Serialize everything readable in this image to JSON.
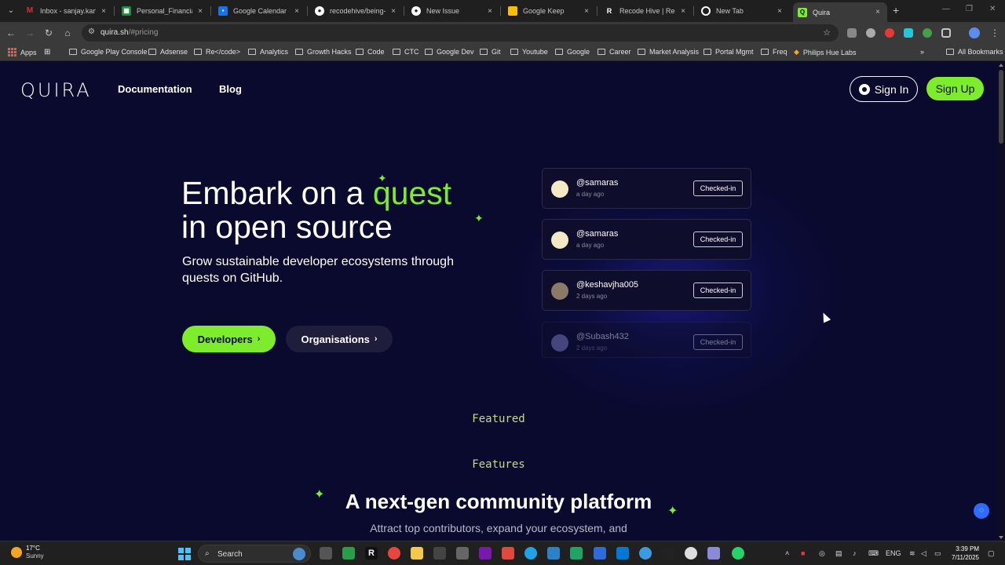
{
  "browser": {
    "tabs": [
      {
        "label": "Inbox - sanjay.kanaki",
        "icon": "gmail-icon",
        "color": "#d93025"
      },
      {
        "label": "Personal_Financial_St",
        "icon": "sheets-icon",
        "color": "#1e8e3e"
      },
      {
        "label": "Google Calendar - W",
        "icon": "calendar-icon",
        "color": "#1a73e8"
      },
      {
        "label": "recodehive/being-an",
        "icon": "github-icon",
        "color": "#ffffff"
      },
      {
        "label": "New Issue",
        "icon": "github-icon",
        "color": "#ffffff"
      },
      {
        "label": "Google Keep",
        "icon": "keep-icon",
        "color": "#fbbc04"
      },
      {
        "label": "Recode Hive | Recod",
        "icon": "recodehive-icon",
        "color": "#ffffff"
      },
      {
        "label": "New Tab",
        "icon": "chrome-icon",
        "color": "#ffffff"
      },
      {
        "label": "Quira",
        "icon": "quira-icon",
        "color": "#7cec2c"
      }
    ],
    "url_host": "quira.sh",
    "url_path": "/#pricing",
    "bookmarks": [
      "Apps",
      "Google Play Console",
      "Adsense",
      "Re</code>",
      "Analytics",
      "Growth Hacks",
      "Code",
      "CTC",
      "Google Dev",
      "Git",
      "Youtube",
      "Google",
      "Career",
      "Market Analysis",
      "Portal Mgmt",
      "Freq",
      "Philips Hue Labs"
    ],
    "all_bookmarks": "All Bookmarks"
  },
  "site": {
    "logo": "QUIRA",
    "nav": {
      "documentation": "Documentation",
      "blog": "Blog"
    },
    "sign_in": "Sign In",
    "sign_up": "Sign Up",
    "hero": {
      "title_part1": "Embark on a ",
      "title_highlight": "quest",
      "title_part2": "in open source",
      "subtitle": "Grow sustainable developer ecosystems through quests on GitHub.",
      "btn_developers": "Developers",
      "btn_organisations": "Organisations"
    },
    "activity": [
      {
        "user": "@samaras",
        "time": "a day ago",
        "status": "Checked-in"
      },
      {
        "user": "@samaras",
        "time": "a day ago",
        "status": "Checked-in"
      },
      {
        "user": "@keshavjha005",
        "time": "2 days ago",
        "status": "Checked-in"
      },
      {
        "user": "@Subash432",
        "time": "2 days ago",
        "status": "Checked-in"
      }
    ],
    "featured": "Featured",
    "features": "Features",
    "section_title": "A next-gen community platform",
    "section_sub": "Attract top contributors, expand your ecosystem, and"
  },
  "taskbar": {
    "weather_temp": "17°C",
    "weather_desc": "Sunny",
    "search_placeholder": "Search",
    "lang": "ENG",
    "time": "3:39 PM",
    "date": "7/11/2025"
  },
  "colors": {
    "accent": "#7cec2c",
    "background": "#0a0a2e"
  }
}
